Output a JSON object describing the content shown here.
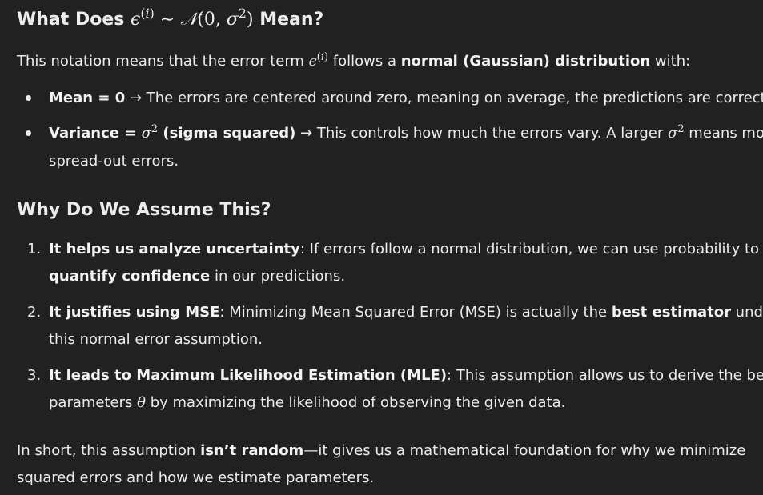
{
  "heading1": {
    "prefix": "What Does ",
    "suffix": " Mean?"
  },
  "intro": {
    "text1": "This notation means that the error term ",
    "text2": " follows a ",
    "bold": "normal (Gaussian) distribution",
    "text3": " with:"
  },
  "bullets": [
    {
      "bold": "Mean = 0",
      "text": " → The errors are centered around zero, meaning on average, the predictions are correct."
    },
    {
      "bold_prefix": "Variance = ",
      "bold_suffix": " (sigma squared)",
      "text1": " → This controls how much the errors vary. A larger ",
      "text2": " means more",
      "line2": "spread-out errors."
    }
  ],
  "heading2": "Why Do We Assume This?",
  "numbered": [
    {
      "num": "1.",
      "bold": "It helps us analyze uncertainty",
      "text": ": If errors follow a normal distribution, we can use probability to",
      "line2_bold": "quantify confidence",
      "line2_text": " in our predictions."
    },
    {
      "num": "2.",
      "bold": "It justifies using MSE",
      "text1": ": Minimizing Mean Squared Error (MSE) is actually the ",
      "bold2": "best estimator",
      "text2": " under",
      "line2": "this normal error assumption."
    },
    {
      "num": "3.",
      "bold": "It leads to Maximum Likelihood Estimation (MLE)",
      "text": ": This assumption allows us to derive the best",
      "line2_text1": "parameters ",
      "line2_text2": " by maximizing the likelihood of observing the given data."
    }
  ],
  "summary": {
    "text1": "In short, this assumption ",
    "bold": "isn’t random",
    "text2": "—it gives us a mathematical foundation for why we minimize",
    "line2": "squared errors and how we estimate parameters."
  }
}
